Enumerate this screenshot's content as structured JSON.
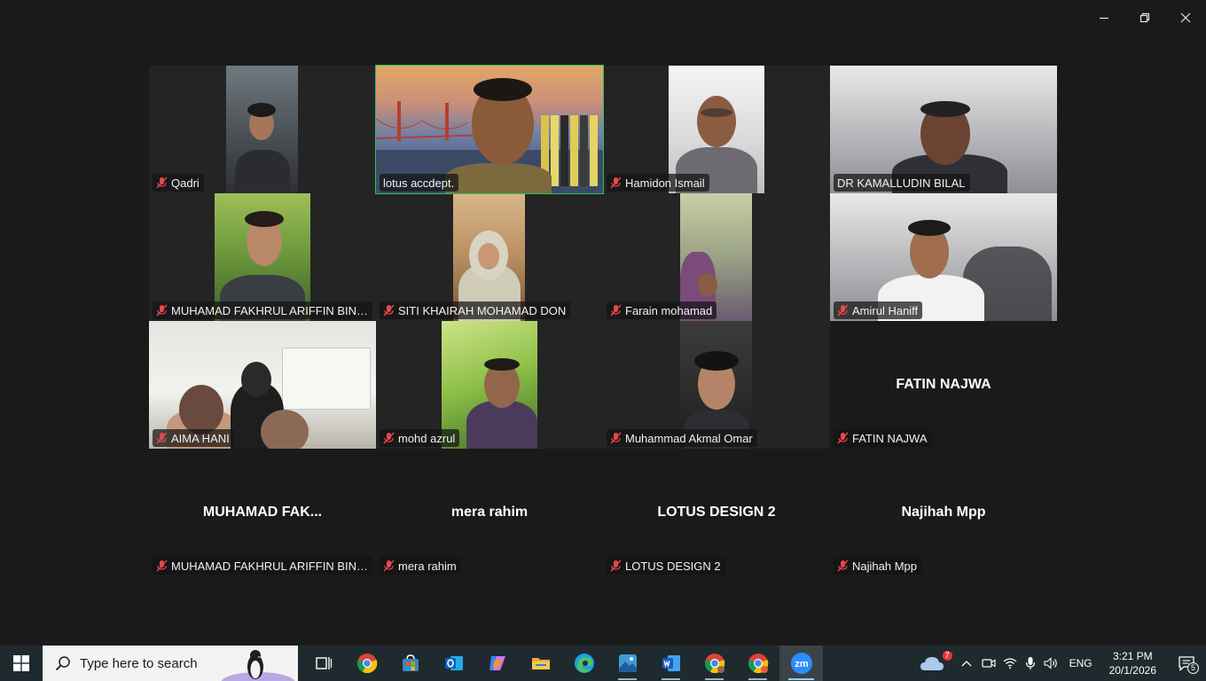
{
  "window": {
    "controls": [
      "minimize",
      "restore",
      "close"
    ]
  },
  "participants": [
    {
      "name": "Qadri",
      "muted": true,
      "video": true
    },
    {
      "name": "lotus accdept.",
      "muted": false,
      "video": true,
      "active_speaker": true
    },
    {
      "name": "Hamidon Ismail",
      "muted": true,
      "video": true
    },
    {
      "name": "DR KAMALLUDIN BILAL",
      "muted": true,
      "video": true
    },
    {
      "name": "MUHAMAD FAKHRUL ARIFFIN BIN KA...",
      "muted": true,
      "video": true
    },
    {
      "name": "SITI KHAIRAH MOHAMAD DON",
      "muted": true,
      "video": true
    },
    {
      "name": "Farain mohamad",
      "muted": true,
      "video": true
    },
    {
      "name": "Amirul Haniff",
      "muted": true,
      "video": true
    },
    {
      "name": "AIMA HANI",
      "muted": true,
      "video": true
    },
    {
      "name": "mohd azrul",
      "muted": true,
      "video": true
    },
    {
      "name": "Muhammad Akmal Omar",
      "muted": true,
      "video": true
    },
    {
      "name": "FATIN NAJWA",
      "display_name": "FATIN NAJWA",
      "muted": true,
      "video": false
    },
    {
      "name": "MUHAMAD FAKHRUL ARIFFIN BIN KA...",
      "display_name": "MUHAMAD  FAK...",
      "muted": true,
      "video": false
    },
    {
      "name": "mera rahim",
      "display_name": "mera rahim",
      "muted": true,
      "video": false
    },
    {
      "name": "LOTUS DESIGN 2",
      "display_name": "LOTUS DESIGN 2",
      "muted": true,
      "video": false
    },
    {
      "name": "Najihah Mpp",
      "display_name": "Najihah Mpp",
      "muted": true,
      "video": false
    }
  ],
  "taskbar": {
    "search_placeholder": "Type here to search",
    "apps": [
      "Task View",
      "Google Chrome",
      "Microsoft Store",
      "Outlook",
      "Copilot",
      "File Explorer",
      "Microsoft Edge",
      "Photos",
      "Microsoft Word",
      "Google Chrome",
      "Google Chrome",
      "Zoom"
    ],
    "weather_badge": "7",
    "language": "ENG",
    "time": "3:21 PM",
    "date": "20/1/2026",
    "notifications_count": "5"
  },
  "colors": {
    "background": "#1a1a1a",
    "active_speaker_border": "#22c55e",
    "taskbar": "#1f2a2e",
    "muted_icon": "#e5484d"
  }
}
